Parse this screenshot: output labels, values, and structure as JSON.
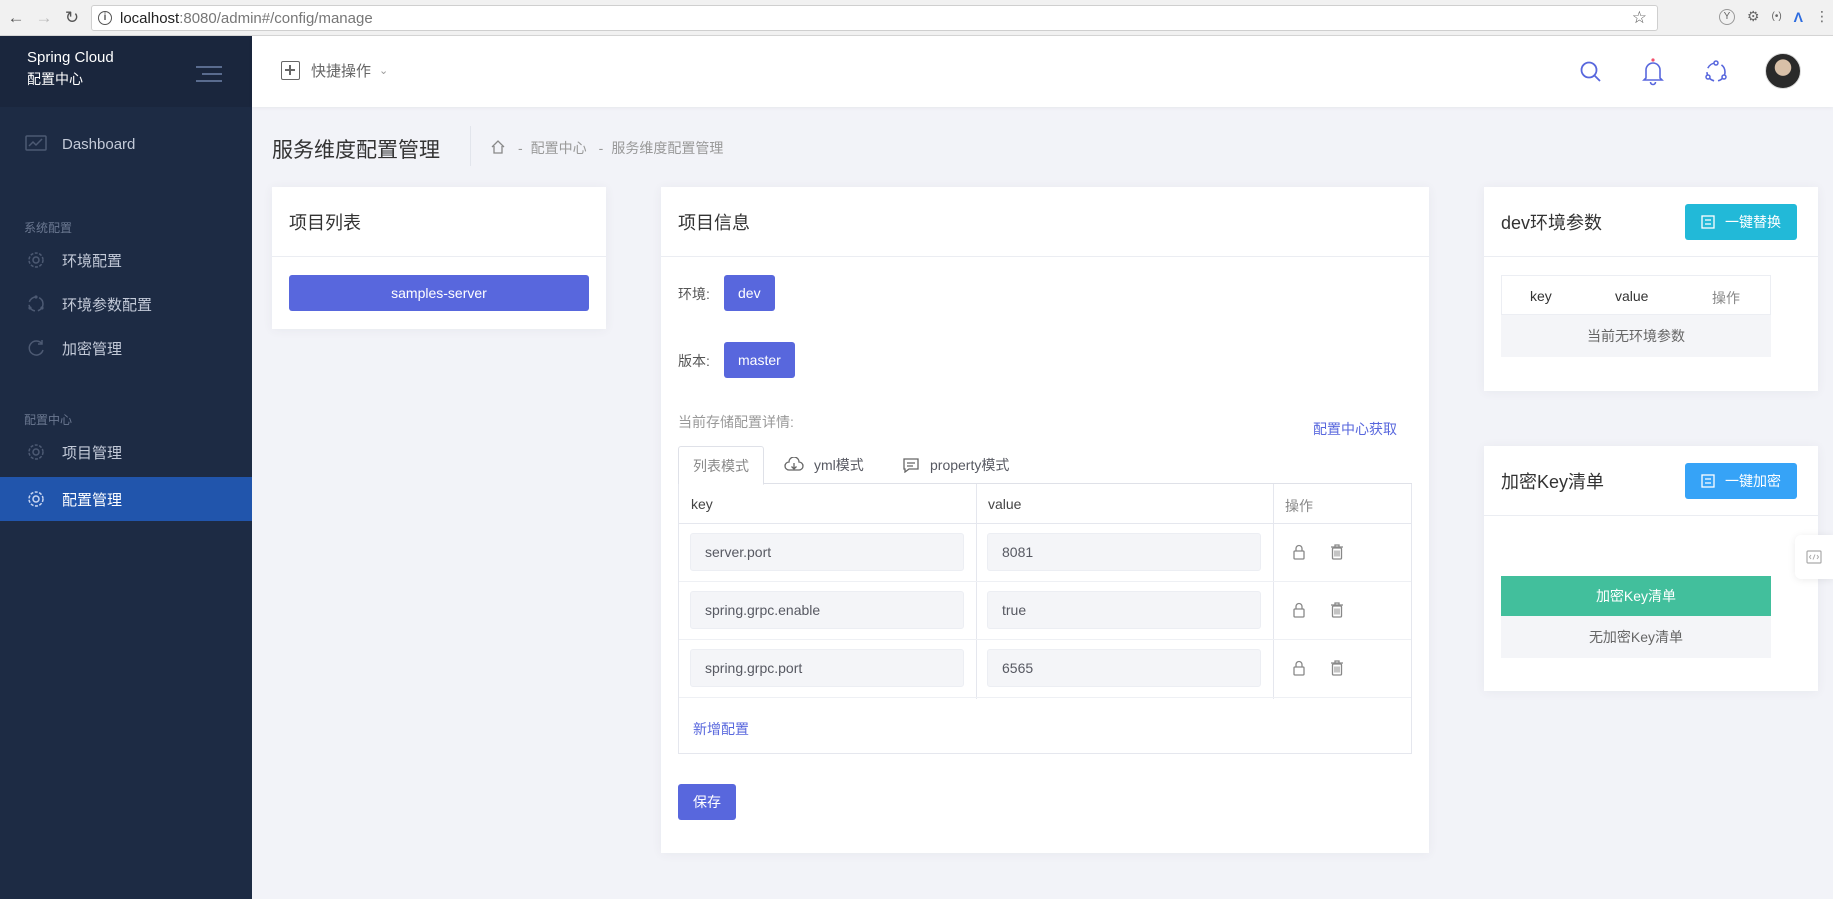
{
  "browser": {
    "url_host": "localhost",
    "url_rest": ":8080/admin#/config/manage"
  },
  "sidebar": {
    "brand_line1": "Spring Cloud",
    "brand_line2": "配置中心",
    "dashboard": "Dashboard",
    "section_system": "系统配置",
    "env_config": "环境配置",
    "env_param_config": "环境参数配置",
    "encrypt_manage": "加密管理",
    "section_config_center": "配置中心",
    "project_manage": "项目管理",
    "config_manage": "配置管理"
  },
  "topbar": {
    "quick_actions": "快捷操作"
  },
  "page": {
    "title": "服务维度配置管理",
    "crumb1": "配置中心",
    "crumb2": "服务维度配置管理",
    "crumb_sep": "-"
  },
  "project_list": {
    "title": "项目列表",
    "items": [
      "samples-server"
    ]
  },
  "project_info": {
    "title": "项目信息",
    "env_label": "环境:",
    "env_value": "dev",
    "version_label": "版本:",
    "version_value": "master",
    "storage_label": "当前存储配置详情:",
    "fetch_link": "配置中心获取",
    "tabs": [
      "列表模式",
      "yml模式",
      "property模式"
    ],
    "table_headers": [
      "key",
      "value",
      "操作"
    ],
    "rows": [
      {
        "key": "server.port",
        "value": "8081"
      },
      {
        "key": "spring.grpc.enable",
        "value": "true"
      },
      {
        "key": "spring.grpc.port",
        "value": "6565"
      }
    ],
    "add_link": "新增配置",
    "save_button": "保存"
  },
  "env_params": {
    "title": "dev环境参数",
    "action_button": "一键替换",
    "headers": [
      "key",
      "value",
      "操作"
    ],
    "empty_text": "当前无环境参数"
  },
  "encrypt_keys": {
    "title": "加密Key清单",
    "action_button": "一键加密",
    "list_header": "加密Key清单",
    "empty_text": "无加密Key清单"
  },
  "colors": {
    "primary": "#5867dd",
    "info": "#36a3f7",
    "cyan": "#22b9d8",
    "success": "#42bf9c",
    "sidebar": "#1d2b44",
    "sidebar_active": "#2155ac"
  }
}
